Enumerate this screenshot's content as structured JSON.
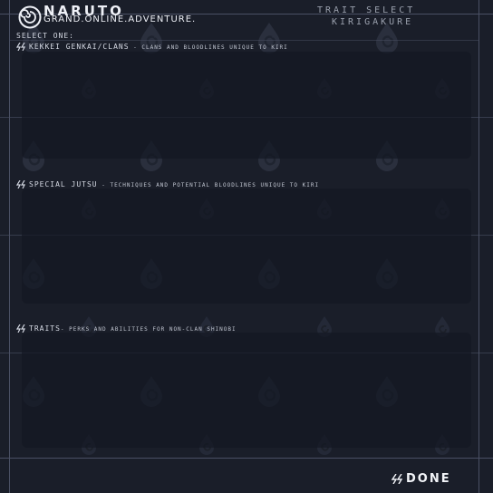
{
  "header": {
    "title": "NARUTO",
    "subtitle": "GRAND.ONLINE.ADVENTURE.",
    "screen_name": "TRAIT SELECT",
    "village": "KIRIGAKURE"
  },
  "prompt": "SELECT ONE:",
  "sections": [
    {
      "title": "KEKKEI GENKAI/CLANS",
      "description": " - CLANS AND BLOODLINES UNIQUE TO KIRI"
    },
    {
      "title": "SPECIAL JUTSU",
      "description": " - TECHNIQUES AND POTENTIAL BLOODLINES UNIQUE TO KIRI"
    },
    {
      "title": "TRAITS",
      "description": "- PERKS AND ABILITIES FOR NON-CLAN SHINOBI"
    }
  ],
  "done_label": "DONE",
  "icons": {
    "logo": "konoha-swirl-icon",
    "bolt": "double-bolt-icon",
    "watermark": "water-drop-emblem-icon"
  },
  "colors": {
    "background": "#1a1e29",
    "panel": "#141822",
    "frame_line": "#4a5064",
    "text": "#d4d8e2",
    "muted_text": "#9aa0ad"
  }
}
